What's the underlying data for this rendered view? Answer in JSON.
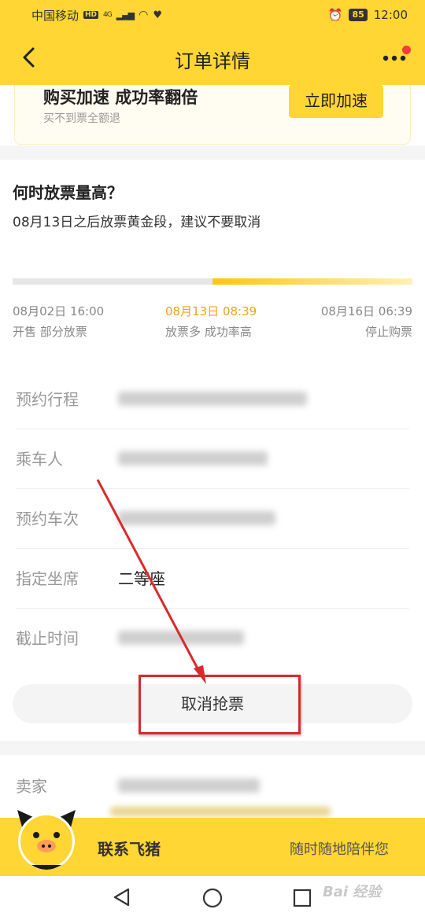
{
  "status_bar": {
    "carrier": "中国移动",
    "hd": "HD",
    "net": "4G",
    "battery": "85",
    "time": "12:00"
  },
  "nav": {
    "title": "订单详情"
  },
  "speed_card": {
    "title": "购买加速 成功率翻倍",
    "subtitle": "买不到票全额退",
    "button": "立即加速"
  },
  "release": {
    "title": "何时放票量高？",
    "desc": "08月13日之后放票黄金段，建议不要取消",
    "timeline": [
      {
        "date": "08月02日 16:00",
        "desc": "开售 部分放票"
      },
      {
        "date": "08月13日 08:39",
        "desc": "放票多 成功率高"
      },
      {
        "date": "08月16日 06:39",
        "desc": "停止购票"
      }
    ],
    "progress_fraction": 0.5
  },
  "details": {
    "rows": [
      {
        "label": "预约行程"
      },
      {
        "label": "乘车人"
      },
      {
        "label": "预约车次"
      },
      {
        "label": "指定坐席",
        "value": "二等座"
      },
      {
        "label": "截止时间"
      }
    ]
  },
  "cancel_button": "取消抢票",
  "seller": {
    "label": "卖家"
  },
  "contact": {
    "label": "联系飞猪",
    "sub": "随时随地陪伴您"
  },
  "watermark": "Bai 经验",
  "colors": {
    "brand_yellow": "#ffd633",
    "highlight_orange": "#f0a216",
    "annotation_red": "#d92b2b"
  }
}
